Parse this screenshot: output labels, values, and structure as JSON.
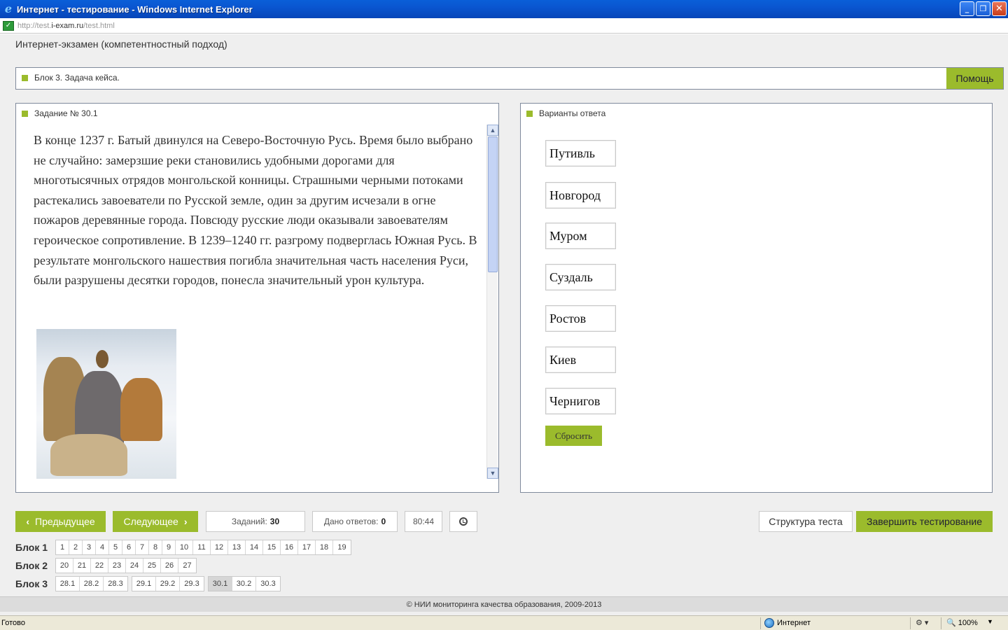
{
  "window": {
    "title": "Интернет - тестирование - Windows Internet Explorer",
    "minimize": "_",
    "restore": "❐",
    "close": "✕"
  },
  "address": {
    "url_prefix": "http://test.",
    "url_host": "i-exam.ru",
    "url_path": "/test.html"
  },
  "page": {
    "header": "Интернет-экзамен (компетентностный подход)",
    "block_title": "Блок 3. Задача кейса.",
    "help_label": "Помощь"
  },
  "task": {
    "title": "Задание № 30.1",
    "text": "В конце 1237 г. Батый двинулся на Северо-Восточную Русь. Время было выбрано не случайно: замерзшие реки становились удобными дорогами для многотысячных отрядов монгольской конницы. Страшными черными потоками растекались завоеватели по Русской земле, один за другим исчезали в огне пожаров деревянные города. Повсюду русские люди оказывали завоевателям героическое сопротивление. В 1239–1240 гг. разгрому подверглась Южная Русь. В результате монгольского нашествия погибла значительная часть населения Руси, были разрушены десятки городов, понесла значительный урон культура.",
    "scroll_up": "▲",
    "scroll_down": "▼"
  },
  "answers": {
    "title": "Варианты ответа",
    "options": [
      "Путивль",
      "Новгород",
      "Муром",
      "Суздаль",
      "Ростов",
      "Киев",
      "Чернигов"
    ],
    "reset_label": "Сбросить"
  },
  "controls": {
    "prev_label": "Предыдущее",
    "prev_chevron": "‹",
    "next_label": "Следующее",
    "next_chevron": "›",
    "tasks_label": "Заданий:",
    "tasks_count": "30",
    "answered_label": "Дано ответов:",
    "answered_count": "0",
    "timer": "80:44",
    "structure_label": "Структура теста",
    "finish_label": "Завершить тестирование"
  },
  "blocks": [
    {
      "label": "Блок 1",
      "groups": [
        [
          "1",
          "2",
          "3",
          "4",
          "5",
          "6",
          "7",
          "8",
          "9",
          "10",
          "11",
          "12",
          "13",
          "14",
          "15",
          "16",
          "17",
          "18",
          "19"
        ]
      ]
    },
    {
      "label": "Блок 2",
      "groups": [
        [
          "20",
          "21",
          "22",
          "23",
          "24",
          "25",
          "26",
          "27"
        ]
      ]
    },
    {
      "label": "Блок 3",
      "groups": [
        [
          "28.1",
          "28.2",
          "28.3"
        ],
        [
          "29.1",
          "29.2",
          "29.3"
        ],
        [
          "30.1",
          "30.2",
          "30.3"
        ]
      ],
      "active": "30.1"
    }
  ],
  "footer": "© НИИ мониторинга качества образования, 2009-2013",
  "status": {
    "text": "Готово",
    "zone": "Интернет",
    "protected_icon": "⚙ ▾",
    "zoom_icon": "🔍",
    "zoom": "100%",
    "zoom_dropdown": "▼"
  },
  "colors": {
    "accent": "#9bbb2c",
    "titlebar": "#0a55d0",
    "panel_border": "#7f8a9c"
  }
}
